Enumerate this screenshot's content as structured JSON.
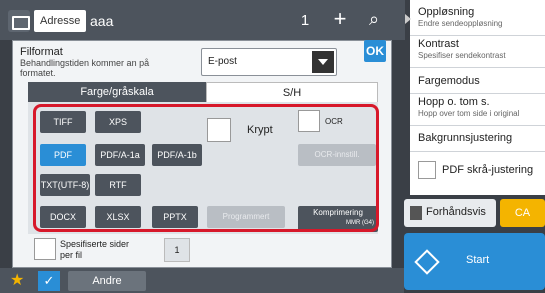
{
  "topbar": {
    "address_label": "Adresse",
    "address_value": "aaa",
    "count": "1",
    "add_symbol": "+",
    "search_symbol": "⌕"
  },
  "sidepanel": {
    "items": [
      {
        "title": "Oppløsning",
        "sub": "Endre sendeoppløsning"
      },
      {
        "title": "Kontrast",
        "sub": "Spesifiser sendekontrast"
      },
      {
        "title": "Fargemodus",
        "sub": ""
      },
      {
        "title": "Hopp o. tom s.",
        "sub": "Hopp over tom side i original"
      },
      {
        "title": "Bakgrunnsjustering",
        "sub": ""
      }
    ],
    "pdf_skew_label": "PDF skrå-justering"
  },
  "actions": {
    "preview_label": "Forhåndsvis",
    "ca_label": "CA",
    "start_label": "Start"
  },
  "bottombar": {
    "andre_label": "Andre"
  },
  "dialog": {
    "title": "Filformat",
    "note": "Behandlingstiden kommer an på formatet.",
    "select_value": "E-post",
    "ok_label": "OK",
    "tabs": {
      "color": "Farge/gråskala",
      "sh": "S/H"
    },
    "formats": {
      "tiff": "TIFF",
      "xps": "XPS",
      "pdf": "PDF",
      "pdfa1a": "PDF/A-1a",
      "pdfa1b": "PDF/A-1b",
      "txt": "TXT(UTF-8)",
      "rtf": "RTF",
      "docx": "DOCX",
      "xlsx": "XLSX",
      "pptx": "PPTX",
      "program": "Programmert",
      "compression": "Komprimering",
      "compression_sub": "MMR (G4)",
      "ocr_settings": "OCR-innstill."
    },
    "encrypt_label": "Krypt",
    "ocr_label": "OCR",
    "specified_pages_label": "Spesifiserte sider per fil",
    "specified_pages_count": "1"
  },
  "colors": {
    "accent": "#2a8ed6",
    "highlight": "#d7182a",
    "ca": "#f4b400"
  }
}
